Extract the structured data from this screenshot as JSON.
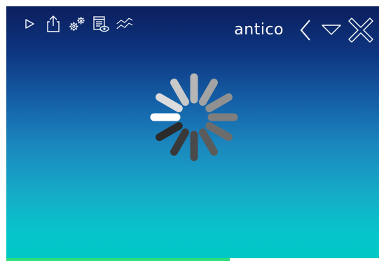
{
  "toolbar": {
    "left_icons": [
      {
        "name": "play-icon"
      },
      {
        "name": "share-icon"
      },
      {
        "name": "settings-gears-icon"
      },
      {
        "name": "document-preview-icon"
      },
      {
        "name": "chart-trend-icon"
      }
    ],
    "brand": "antico",
    "right_icons": [
      {
        "name": "chevron-left-icon"
      },
      {
        "name": "triangle-down-icon"
      },
      {
        "name": "close-icon"
      }
    ]
  },
  "loading_spinner": {
    "spokes": 12,
    "active_spoke": 9
  },
  "progress": {
    "value": 0.6
  },
  "colors": {
    "background_top": "#0b1f5e",
    "background_bottom": "#00c8c4",
    "progress_fill": "#2ee07a",
    "icon": "#ffffff"
  }
}
